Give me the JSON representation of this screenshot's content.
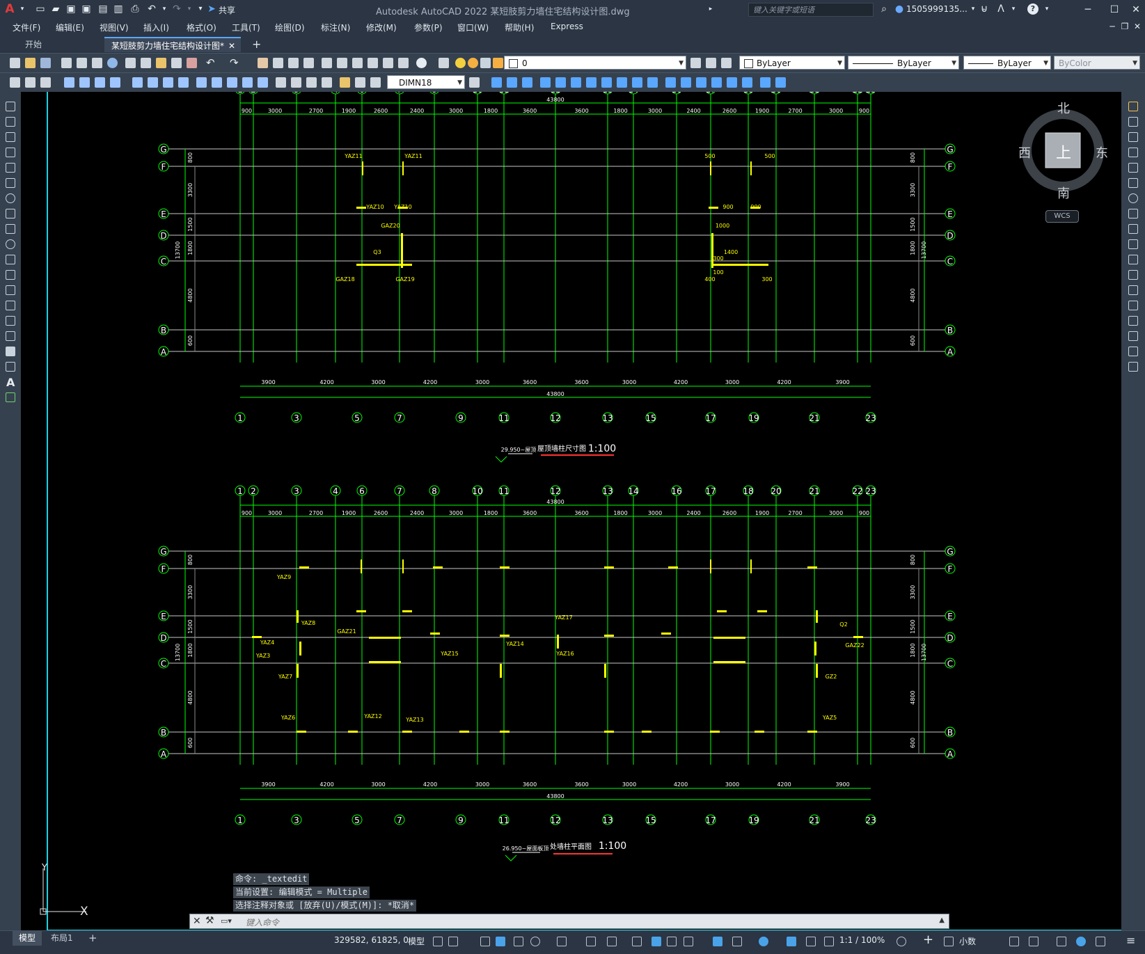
{
  "app": {
    "logo": "A",
    "window_title": "Autodesk AutoCAD 2022    某短肢剪力墙住宅结构设计图.dwg",
    "share_label": "共享",
    "search_placeholder": "键入关键字或短语",
    "user": "1505999135...",
    "controls": {
      "minimize": "─",
      "restore": "☐",
      "close": "✕"
    },
    "doc_controls": {
      "minimize": "─",
      "restore": "❐",
      "close": "✕"
    }
  },
  "menu": [
    "文件(F)",
    "编辑(E)",
    "视图(V)",
    "插入(I)",
    "格式(O)",
    "工具(T)",
    "绘图(D)",
    "标注(N)",
    "修改(M)",
    "参数(P)",
    "窗口(W)",
    "帮助(H)",
    "Express"
  ],
  "tabs": [
    {
      "label": "开始"
    },
    {
      "label": "某短肢剪力墙住宅结构设计图*",
      "close": "✕"
    }
  ],
  "new_tab": "+",
  "toolbar": {
    "layer_value": "0",
    "color_value": "ByLayer",
    "linetype_value": "ByLayer",
    "lineweight_value": "ByLayer",
    "plotstyle_value": "ByColor",
    "dimstyle_value": "DIMN18"
  },
  "viewcube": {
    "north": "北",
    "south": "南",
    "east": "东",
    "west": "西",
    "face": "上",
    "wcs": "WCS"
  },
  "ucs": {
    "y": "Y",
    "x": "X"
  },
  "drawing": {
    "top_axes_top": [
      "1",
      "2",
      "3",
      "4",
      "6",
      "7",
      "8",
      "10",
      "11",
      "12",
      "13",
      "14",
      "16",
      "17",
      "18",
      "20",
      "21",
      "22",
      "23"
    ],
    "top_dims_top": [
      "900",
      "3000",
      "2700",
      "1900",
      "2600",
      "2400",
      "3000",
      "1800",
      "3600",
      "3600",
      "1800",
      "3000",
      "2400",
      "2600",
      "1900",
      "2700",
      "3000",
      "900"
    ],
    "total": "43800",
    "rows": [
      "G",
      "F",
      "E",
      "D",
      "C",
      "B",
      "A"
    ],
    "left_dims": [
      "800",
      "3300",
      "1500",
      "1800",
      "4800",
      "600",
      "900"
    ],
    "left_total": "13700",
    "bottom_axes": [
      "1",
      "3",
      "5",
      "7",
      "9",
      "11",
      "12",
      "13",
      "15",
      "17",
      "19",
      "21",
      "23"
    ],
    "bottom_dims": [
      "3900",
      "4200",
      "3000",
      "4200",
      "3000",
      "3600",
      "3600",
      "3000",
      "4200",
      "3000",
      "4200",
      "3900"
    ],
    "plan1_title": "屋顶墙柱尺寸图",
    "plan1_scale": "1:100",
    "plan1_elev": "29.950~屋顶",
    "plan2_title": "处墙柱平面图",
    "plan2_scale": "1:100",
    "plan2_elev": "26.950~屋面板顶",
    "plan1_tags": [
      "YAZ11",
      "YAZ11",
      "YAZ10",
      "YAZ10",
      "GAZ20",
      "Q3",
      "GAZ18",
      "GAZ19",
      "500",
      "500",
      "900",
      "900",
      "1000",
      "1400",
      "300",
      "400",
      "100",
      "300"
    ],
    "plan2_tags": [
      "YAZ9",
      "YAZ8",
      "YAZ4",
      "YAZ3",
      "YAZ7",
      "YAZ6",
      "YAZ12",
      "YAZ13",
      "YAZ15",
      "YAZ14",
      "YAZ16",
      "YAZ17",
      "GAZ21",
      "GAZ22",
      "Q2",
      "GZ2",
      "YAZ5"
    ]
  },
  "command": {
    "history": [
      "命令: _textedit",
      "当前设置: 编辑模式 = Multiple",
      "选择注释对象或 [放弃(U)/模式(M)]: *取消*"
    ],
    "input_placeholder": "键入命令"
  },
  "status": {
    "layout_tabs": [
      "模型",
      "布局1"
    ],
    "add_layout": "+",
    "coords": "329582, 61825, 0",
    "space": "模型",
    "scale": "1:1 / 100%",
    "units": "小数"
  }
}
